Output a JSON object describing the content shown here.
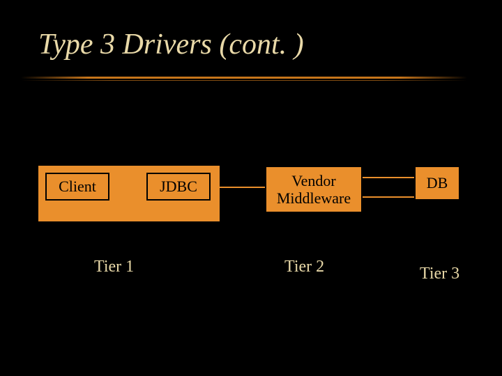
{
  "title": "Type 3 Drivers (cont. )",
  "boxes": {
    "client": "Client",
    "jdbc": "JDBC",
    "middleware": "Vendor Middleware",
    "db": "DB"
  },
  "tiers": {
    "t1": "Tier 1",
    "t2": "Tier 2",
    "t3": "Tier 3"
  },
  "colors": {
    "background": "#000000",
    "accent": "#ea8f2c",
    "text_light": "#e9d9a8"
  }
}
